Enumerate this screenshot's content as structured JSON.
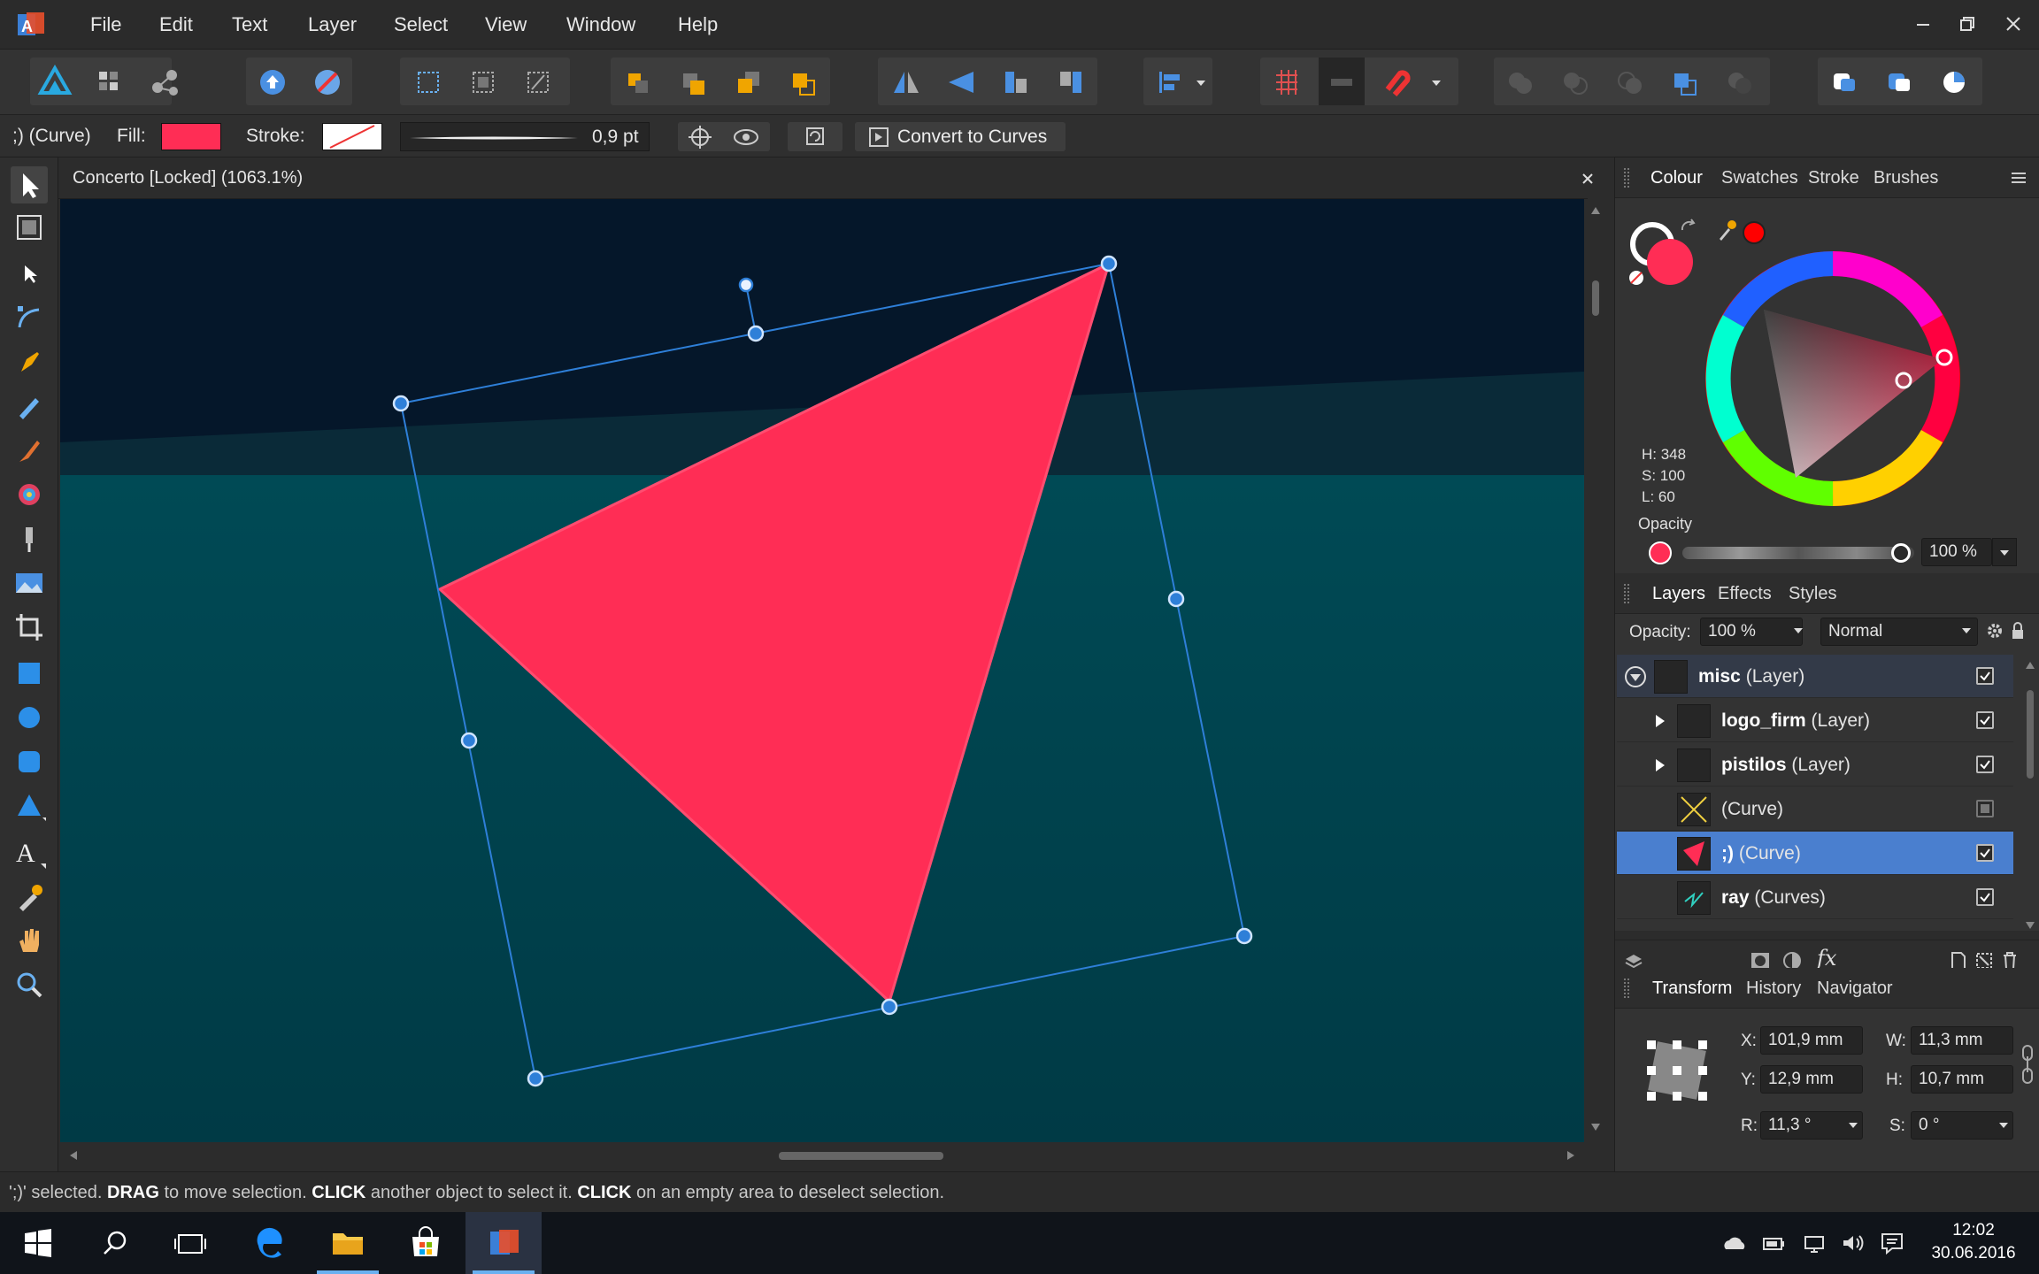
{
  "app": {
    "logo_text": "A"
  },
  "menu": [
    "File",
    "Edit",
    "Text",
    "Layer",
    "Select",
    "View",
    "Window",
    "Help"
  ],
  "context": {
    "selection_label": ";) (Curve)",
    "fill_label": "Fill:",
    "fill_color": "#ff2d55",
    "stroke_label": "Stroke:",
    "stroke_width": "0,9 pt",
    "convert_button": "Convert to Curves"
  },
  "document": {
    "title": "Concerto [Locked] (1063.1%)"
  },
  "colour_panel": {
    "tabs": [
      "Colour",
      "Swatches",
      "Stroke",
      "Brushes"
    ],
    "h": "H: 348",
    "s": "S: 100",
    "l": "L: 60",
    "opacity_label": "Opacity",
    "opacity_value": "100 %",
    "accent": "#ff2d55"
  },
  "layers_panel": {
    "tabs": [
      "Layers",
      "Effects",
      "Styles"
    ],
    "opacity_label": "Opacity:",
    "opacity_value": "100 %",
    "blend_mode": "Normal",
    "rows": [
      {
        "name": "misc",
        "type": "(Layer)"
      },
      {
        "name": "logo_firm",
        "type": "(Layer)"
      },
      {
        "name": "pistilos",
        "type": "(Layer)"
      },
      {
        "name": "",
        "type": "(Curve)"
      },
      {
        "name": ";)",
        "type": "(Curve)"
      },
      {
        "name": "ray",
        "type": "(Curves)"
      }
    ],
    "fx_label": "fx"
  },
  "transform_panel": {
    "tabs": [
      "Transform",
      "History",
      "Navigator"
    ],
    "x_label": "X:",
    "x": "101,9 mm",
    "y_label": "Y:",
    "y": "12,9 mm",
    "w_label": "W:",
    "w": "11,3 mm",
    "h_label": "H:",
    "h": "10,7 mm",
    "r_label": "R:",
    "r": "11,3 °",
    "s_label": "S:",
    "s": "0 °"
  },
  "status": {
    "part1": "';)' selected. ",
    "drag": "DRAG",
    "part2": " to move selection. ",
    "click1": "CLICK",
    "part3": " another object to select it. ",
    "click2": "CLICK",
    "part4": " on an empty area to deselect selection."
  },
  "taskbar": {
    "time": "12:02",
    "date": "30.06.2016"
  }
}
